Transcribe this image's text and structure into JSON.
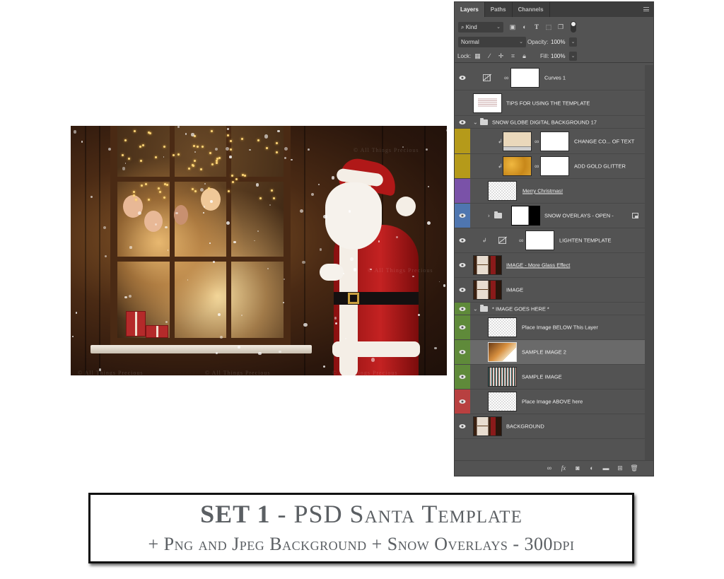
{
  "scene": {
    "description": "Santa Claus outside a snowy frosted window with a family waving from inside",
    "watermark": "© All Things Precious"
  },
  "layers_panel": {
    "tabs": [
      {
        "label": "Layers",
        "active": true
      },
      {
        "label": "Paths",
        "active": false
      },
      {
        "label": "Channels",
        "active": false
      }
    ],
    "filter": {
      "kind_label": "Kind",
      "icons": [
        "pixel-filter-icon",
        "adjustment-filter-icon",
        "type-filter-icon",
        "shape-filter-icon",
        "smart-object-filter-icon"
      ]
    },
    "blend_mode": "Normal",
    "opacity_label": "Opacity:",
    "opacity_value": "100%",
    "lock_label": "Lock:",
    "lock_icons": [
      "lock-transparent-icon",
      "lock-paint-icon",
      "lock-move-icon",
      "lock-artboard-icon",
      "lock-all-icon"
    ],
    "fill_label": "Fill:",
    "fill_value": "100%",
    "layers": [
      {
        "name": "Curves 1",
        "visible": true,
        "color_tag": null,
        "type": "adjustment"
      },
      {
        "name": "TIPS FOR USING THE TEMPLATE",
        "visible": false,
        "color_tag": null,
        "type": "image"
      },
      {
        "name": "SNOW GLOBE DIGITAL BACKGROUND 17",
        "visible": true,
        "color_tag": null,
        "type": "group",
        "expanded": true
      },
      {
        "name": "CHANGE CO... OF TEXT",
        "visible": false,
        "color_tag": "#b59a1a",
        "type": "fill-clipped"
      },
      {
        "name": "ADD GOLD GLITTER",
        "visible": false,
        "color_tag": "#b59a1a",
        "type": "image-clipped"
      },
      {
        "name": "Merry Christmas!",
        "visible": false,
        "color_tag": "#7a52a8",
        "type": "smart",
        "underlined": true
      },
      {
        "name": "SNOW OVERLAYS - OPEN -",
        "visible": true,
        "color_tag": "#4f76b0",
        "type": "group-collapsed"
      },
      {
        "name": "LIGHTEN TEMPLATE",
        "visible": true,
        "color_tag": null,
        "type": "adjustment-clipped"
      },
      {
        "name": "IMAGE - More Glass Effect",
        "visible": true,
        "color_tag": null,
        "type": "image",
        "underlined": true
      },
      {
        "name": "IMAGE",
        "visible": true,
        "color_tag": null,
        "type": "image"
      },
      {
        "name": "* IMAGE GOES HERE *",
        "visible": true,
        "color_tag": "#5f8a3a",
        "type": "group",
        "expanded": true
      },
      {
        "name": "Place Image BELOW This Layer",
        "visible": true,
        "color_tag": "#5f8a3a",
        "type": "empty"
      },
      {
        "name": "SAMPLE IMAGE 2",
        "visible": true,
        "color_tag": "#5f8a3a",
        "type": "image",
        "selected": true
      },
      {
        "name": "SAMPLE IMAGE",
        "visible": true,
        "color_tag": "#5f8a3a",
        "type": "image"
      },
      {
        "name": "Place Image ABOVE here",
        "visible": true,
        "color_tag": "#b84040",
        "type": "empty"
      },
      {
        "name": "BACKGROUND",
        "visible": true,
        "color_tag": null,
        "type": "image"
      }
    ],
    "footer_icons": [
      "link-layers-icon",
      "fx-icon",
      "add-mask-icon",
      "new-adjustment-icon",
      "new-group-icon",
      "new-layer-icon",
      "delete-layer-icon"
    ]
  },
  "banner": {
    "title_bold": "SET 1",
    "title_rest": " - PSD Santa Template",
    "subtitle": "+ Png and Jpeg Background + Snow Overlays - 300dpi"
  }
}
